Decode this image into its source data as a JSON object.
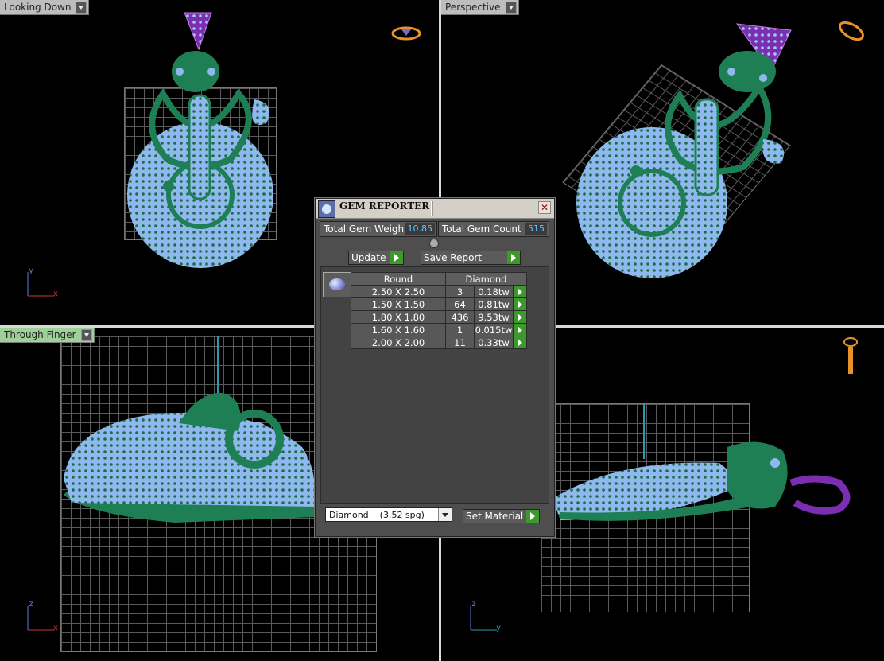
{
  "viewports": {
    "top_left": {
      "label": "Looking Down",
      "axes": [
        "y",
        "x"
      ]
    },
    "top_right": {
      "label": "Perspective"
    },
    "bottom_left": {
      "label": "Through Finger",
      "axes": [
        "z",
        "x"
      ]
    },
    "bottom_right": {
      "axes": [
        "z",
        "y"
      ]
    }
  },
  "dialog": {
    "title": "GEM REPORTER",
    "close_glyph": "✕",
    "total_weight_label": "Total Gem Weight",
    "total_weight_value": "10.85",
    "total_count_label": "Total Gem Count",
    "total_count_value": "515",
    "update_label": "Update",
    "save_report_label": "Save Report",
    "table": {
      "shape_header": "Round",
      "material_header": "Diamond",
      "rows": [
        {
          "size": "2.50 X 2.50",
          "count": "3",
          "weight": "0.18tw"
        },
        {
          "size": "1.50 X 1.50",
          "count": "64",
          "weight": "0.81tw"
        },
        {
          "size": "1.80 X 1.80",
          "count": "436",
          "weight": "9.53tw"
        },
        {
          "size": "1.60 X 1.60",
          "count": "1",
          "weight": "0.015tw"
        },
        {
          "size": "2.00 X 2.00",
          "count": "11",
          "weight": "0.33tw"
        }
      ]
    },
    "material_select": "Diamond    (3.52 spg)",
    "set_material_label": "Set Material"
  },
  "colors": {
    "metal": "#1e7f55",
    "gems": "#8fb9ee",
    "bail": "#7a2fb0",
    "active_label": "#9ed09a"
  }
}
